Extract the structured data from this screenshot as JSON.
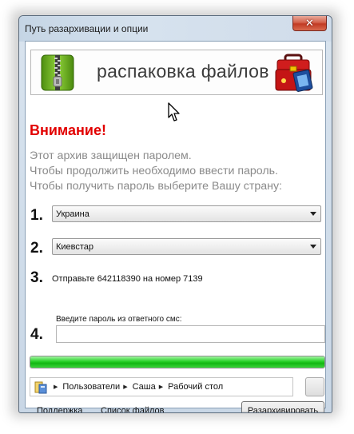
{
  "window": {
    "title": "Путь разархивации и опции",
    "close_glyph": "✕"
  },
  "banner": {
    "text": "распаковка файлов"
  },
  "warning": {
    "title": "Внимание!",
    "lines": [
      "Этот архив защищен паролем.",
      "Чтобы продолжить необходимо ввести пароль.",
      "Чтобы получить пароль выберите Вашу страну:"
    ]
  },
  "steps": {
    "step1": {
      "number": "1.",
      "selected": "Украина"
    },
    "step2": {
      "number": "2.",
      "selected": "Киевстар"
    },
    "step3": {
      "number": "3.",
      "text": "Отправьте 642118390 на номер 7139"
    },
    "step4": {
      "number": "4.",
      "label": "Введите пароль из ответного смс:",
      "value": ""
    }
  },
  "progress": {
    "fraction": 1.0
  },
  "path": {
    "crumbs": [
      "Пользователи",
      "Саша",
      "Рабочий стол"
    ]
  },
  "footer": {
    "support_link": "Поддержка",
    "files_link": "Список файлов",
    "extract_button": "Разархивировать"
  },
  "colors": {
    "warning_red": "#e20000",
    "message_gray": "#8a8a8a",
    "progress_green": "#13b613"
  },
  "icons": {
    "archive": "zipper-archive-icon",
    "toolbox": "toolbox-icon",
    "folder": "folder-icon",
    "cursor": "mouse-cursor-icon",
    "close": "close-icon"
  }
}
